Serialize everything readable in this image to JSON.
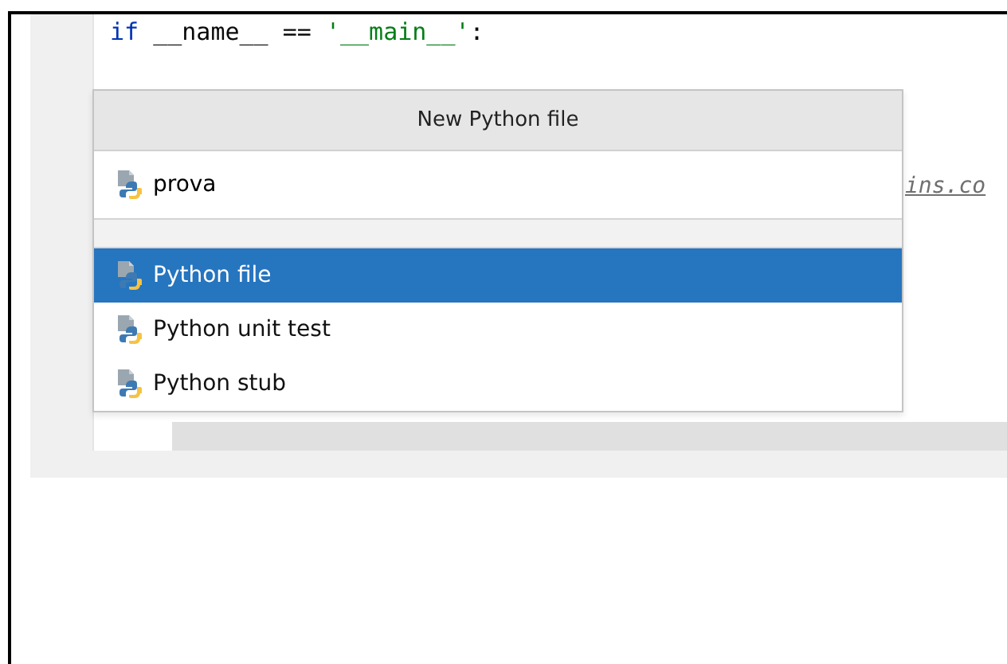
{
  "editor": {
    "code_line": [
      {
        "kind": "keyword",
        "text": "if"
      },
      {
        "kind": "plain",
        "text": " __name__ == "
      },
      {
        "kind": "string",
        "text": "'__main__'"
      },
      {
        "kind": "plain",
        "text": ":"
      }
    ],
    "link_fragment": "ins.co"
  },
  "popup": {
    "title": "New Python file",
    "input": {
      "value": "prova"
    },
    "items": [
      {
        "label": "Python file",
        "selected": true
      },
      {
        "label": "Python unit test",
        "selected": false
      },
      {
        "label": "Python stub",
        "selected": false
      }
    ]
  }
}
